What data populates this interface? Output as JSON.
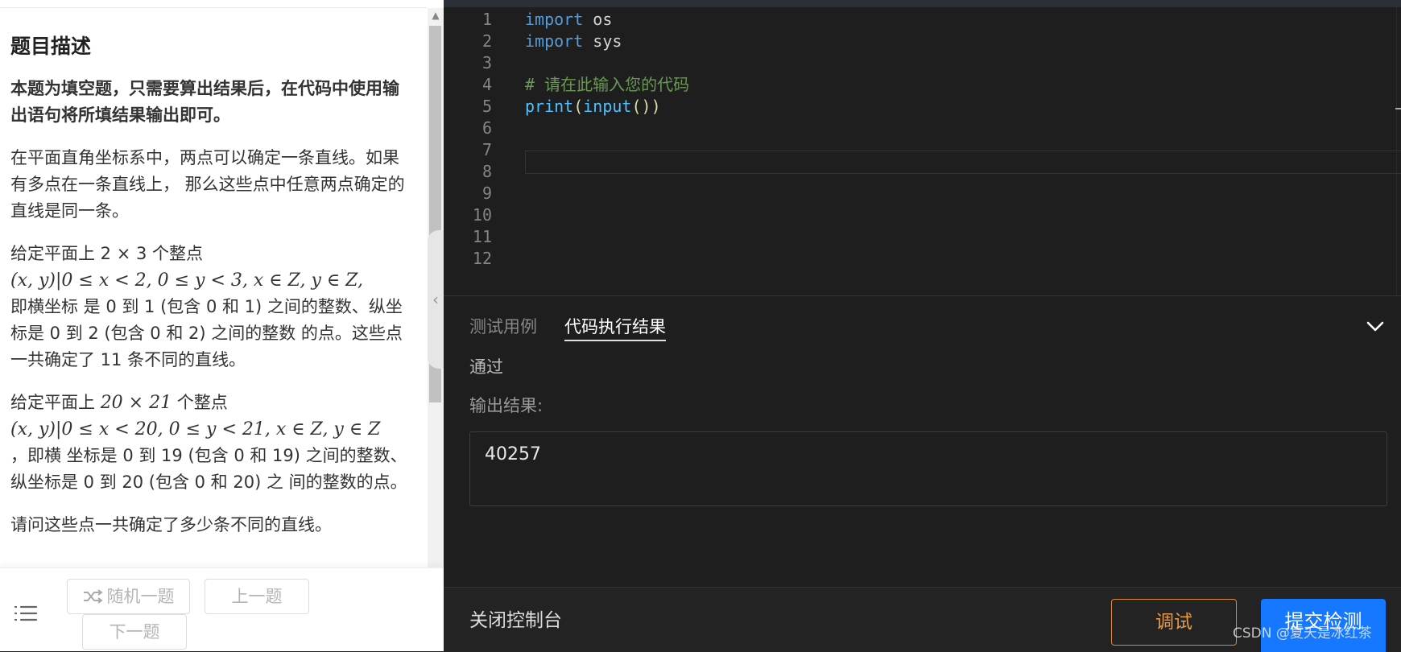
{
  "problem": {
    "title": "题目描述",
    "notice": "本题为填空题，只需要算出结果后，在代码中使用输出语句将所填结果输出即可。",
    "para1": "在平面直角坐标系中，两点可以确定一条直线。如果有多点在一条直线上， 那么这些点中任意两点确定的直线是同一条。",
    "para2_a": "给定平面上 2 × 3 个整点",
    "para2_math": "(x, y)|0 ≤ x < 2, 0 ≤ y < 3, x ∈ Z, y ∈ Z,",
    "para2_b": "即横坐标 是 0 到 1 (包含 0 和 1) 之间的整数、纵坐标是 0 到 2 (包含 0 和 2) 之间的整数 的点。这些点一共确定了 11 条不同的直线。",
    "para3_a": "给定平面上",
    "para3_num": "20 × 21",
    "para3_b": "个整点",
    "para3_math": "(x, y)|0 ≤ x < 20, 0 ≤ y < 21, x ∈ Z, y ∈ Z",
    "para3_c": "，即横 坐标是 0 到 19 (包含 0 和 19) 之间的整数、纵坐标是 0 到 20 (包含 0 和 20) 之 间的整数的点。",
    "para4_partial": "请问这些点一共确定了多少条不同的直线。"
  },
  "nav": {
    "menu_icon": "list-icon",
    "random_icon": "shuffle-icon",
    "random_label": "随机一题",
    "prev_label": "上一题",
    "next_label": "下一题"
  },
  "editor": {
    "lines": [
      {
        "n": "1",
        "tokens": [
          {
            "t": "import",
            "c": "kw"
          },
          {
            "t": " os",
            "c": ""
          }
        ]
      },
      {
        "n": "2",
        "tokens": [
          {
            "t": "import",
            "c": "kw"
          },
          {
            "t": " sys",
            "c": ""
          }
        ]
      },
      {
        "n": "3",
        "tokens": []
      },
      {
        "n": "4",
        "tokens": [
          {
            "t": "# 请在此输入您的代码",
            "c": "cm"
          }
        ]
      },
      {
        "n": "5",
        "tokens": [
          {
            "t": "print",
            "c": "bi"
          },
          {
            "t": "(",
            "c": "fn"
          },
          {
            "t": "input",
            "c": "bi"
          },
          {
            "t": "())",
            "c": "fn"
          }
        ]
      },
      {
        "n": "6",
        "tokens": []
      },
      {
        "n": "7",
        "tokens": []
      },
      {
        "n": "8",
        "tokens": []
      },
      {
        "n": "9",
        "tokens": []
      },
      {
        "n": "10",
        "tokens": []
      },
      {
        "n": "11",
        "tokens": []
      },
      {
        "n": "12",
        "tokens": []
      }
    ]
  },
  "console": {
    "tab_testcase": "测试用例",
    "tab_result": "代码执行结果",
    "collapse_icon": "chevron-down-icon",
    "status": "通过",
    "output_label": "输出结果:",
    "output_value": "40257"
  },
  "bottom": {
    "close_console": "关闭控制台",
    "debug_label": "调试",
    "submit_label": "提交检测"
  },
  "watermark": "CSDN @夏天是冰红茶",
  "colors": {
    "accent": "#1677ff",
    "debug": "#e59a4a",
    "keyword": "#569cd6",
    "comment": "#6a9955"
  }
}
